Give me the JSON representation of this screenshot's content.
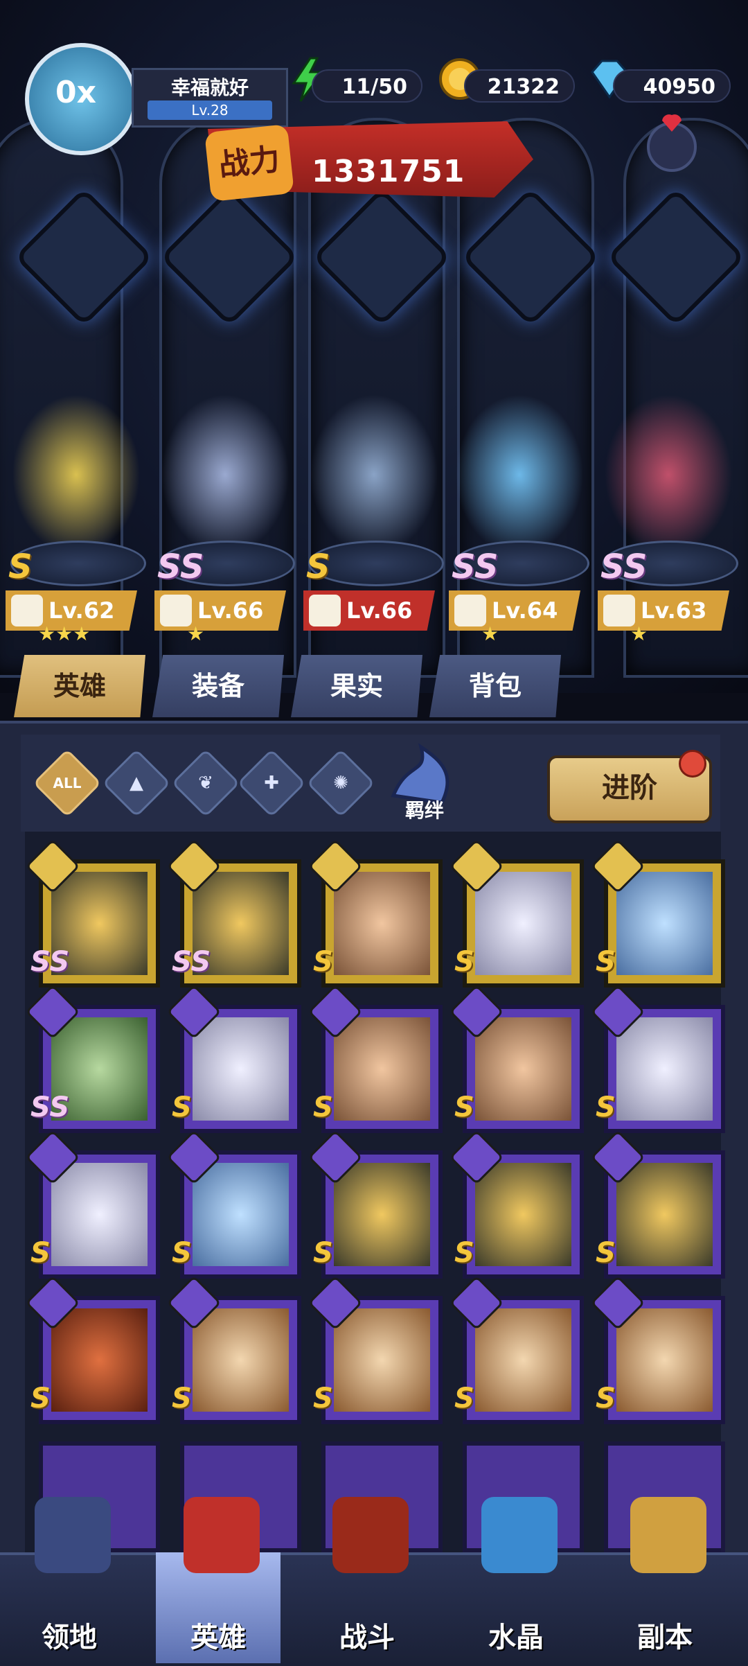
{
  "player": {
    "name": "幸福就好",
    "level": "Lv.28",
    "avatar_badge": "0x"
  },
  "resources": {
    "energy": "11/50",
    "gold": "21322",
    "diamonds": "40950"
  },
  "power": {
    "label": "战力",
    "value": "1331751"
  },
  "lineup": [
    {
      "level": "Lv.62",
      "rank": "S",
      "stars": "★★★",
      "class_icon": "wing-icon",
      "tag_color": "gold"
    },
    {
      "level": "Lv.66",
      "rank": "SS",
      "stars": "★",
      "class_icon": "mage-icon",
      "tag_color": "gold"
    },
    {
      "level": "Lv.66",
      "rank": "S",
      "stars": "",
      "class_icon": "wrench-icon",
      "tag_color": "red"
    },
    {
      "level": "Lv.64",
      "rank": "SS",
      "stars": "★",
      "class_icon": "wrench-icon",
      "tag_color": "gold"
    },
    {
      "level": "Lv.63",
      "rank": "SS",
      "stars": "★",
      "class_icon": "wing-icon",
      "tag_color": "gold"
    }
  ],
  "tabs": [
    "英雄",
    "装备",
    "果实",
    "背包"
  ],
  "filters": {
    "all": "ALL"
  },
  "bond_label": "羁绊",
  "advance_label": "进阶",
  "grid": [
    [
      {
        "rank": "SS",
        "frame": "gold",
        "face": "bot"
      },
      {
        "rank": "SS",
        "frame": "gold",
        "face": "bot"
      },
      {
        "rank": "S",
        "frame": "gold",
        "face": "skin"
      },
      {
        "rank": "S",
        "frame": "gold",
        "face": "white"
      },
      {
        "rank": "S",
        "frame": "gold",
        "face": "blue"
      }
    ],
    [
      {
        "rank": "SS",
        "frame": "purple",
        "face": "green"
      },
      {
        "rank": "S",
        "frame": "purple",
        "face": "white"
      },
      {
        "rank": "S",
        "frame": "purple",
        "face": "skin"
      },
      {
        "rank": "S",
        "frame": "purple",
        "face": "skin"
      },
      {
        "rank": "S",
        "frame": "purple",
        "face": "white"
      }
    ],
    [
      {
        "rank": "S",
        "frame": "purple",
        "face": "white"
      },
      {
        "rank": "S",
        "frame": "purple",
        "face": "blue"
      },
      {
        "rank": "S",
        "frame": "purple",
        "face": "bot"
      },
      {
        "rank": "S",
        "frame": "purple",
        "face": "bot"
      },
      {
        "rank": "S",
        "frame": "purple",
        "face": "bot"
      }
    ],
    [
      {
        "rank": "S",
        "frame": "purple",
        "face": "red"
      },
      {
        "rank": "S",
        "frame": "purple",
        "face": "cat"
      },
      {
        "rank": "S",
        "frame": "purple",
        "face": "cat"
      },
      {
        "rank": "S",
        "frame": "purple",
        "face": "cat"
      },
      {
        "rank": "S",
        "frame": "purple",
        "face": "cat"
      }
    ]
  ],
  "nav": [
    "领地",
    "英雄",
    "战斗",
    "水晶",
    "副本"
  ]
}
